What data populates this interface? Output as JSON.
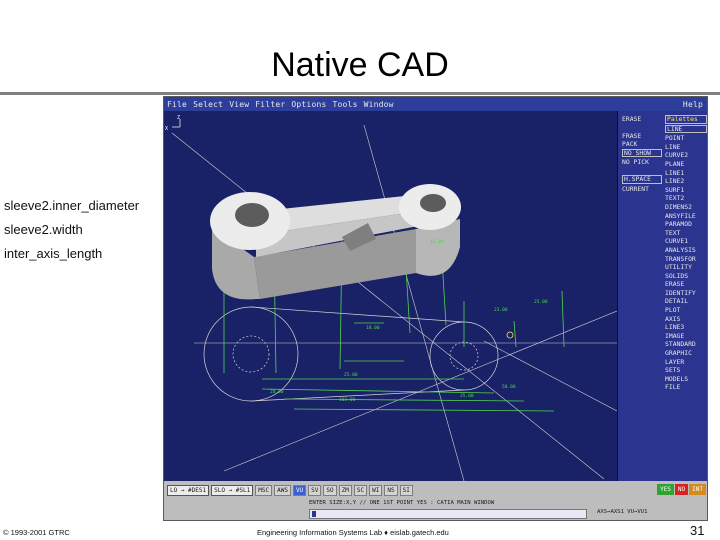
{
  "slide": {
    "title": "Native CAD",
    "labels": [
      "sleeve2.inner_diameter",
      "sleeve2.width",
      "inter_axis_length"
    ],
    "footer_left": "© 1993-2001 GTRC",
    "footer_center": "Engineering Information Systems Lab  ♦ eislab.gatech.edu",
    "page_number": "31"
  },
  "cad": {
    "menubar": [
      "File",
      "Select",
      "View",
      "Filter",
      "Options",
      "Tools",
      "Window"
    ],
    "help": "Help",
    "axis_labels": {
      "z": "Z",
      "x": "X"
    },
    "right_menu_left": [
      "ERASE",
      "FRASE",
      "PACK",
      "NO SHOW",
      "NO PICK",
      "H.SPACE",
      "CURRENT"
    ],
    "right_menu_right": [
      "Palettes",
      "LINE",
      "POINT",
      "LINE",
      "CURVE2",
      "PLANE",
      "LINE1",
      "LINE2",
      "SURF1",
      "TEXT2",
      "DIMENS2",
      "ANSYFILE",
      "PARAMOD",
      "TEXT",
      "CURVE1",
      "ANALYSIS",
      "TRANSFOR",
      "UTILITY",
      "SOLIDS",
      "ERASE",
      "IDENTIFY",
      "DETAIL",
      "PLOT",
      "AXIS",
      "LINE3",
      "IMAGE",
      "STANDARD",
      "GRAPHIC",
      "LAYER",
      "SETS",
      "MODELS",
      "FILE"
    ],
    "bottom_buttons": [
      "LO → #DES1",
      "SLO → #SL1",
      "MSC",
      "AWS",
      "VU",
      "SV",
      "SO",
      "ZM",
      "SC",
      "WI",
      "NS",
      "SI"
    ],
    "prompt": "ENTER SIZE:X,Y // ONE 1ST POINT      YES : CATIA MAIN WINDOW",
    "status_readout": "AXS→AXS1          VU→VU1",
    "status_buttons": [
      {
        "label": "YES",
        "color": "#2fa32f"
      },
      {
        "label": "NO",
        "color": "#d42323"
      },
      {
        "label": "INT",
        "color": "#d48a1e"
      }
    ],
    "dim_labels": [
      "25.00",
      "35.00",
      "50.00",
      "102.00",
      "10.00",
      "45.00",
      "23.00",
      "25.00",
      "20.00"
    ],
    "colors": {
      "viewport_bg": "#1a2267",
      "menu_bg": "#2b3590",
      "part_fill": "#e6e6e6",
      "dimension": "#4fd44f",
      "construction": "#d9d9d9",
      "accent_yellow": "#ffe74a"
    }
  }
}
